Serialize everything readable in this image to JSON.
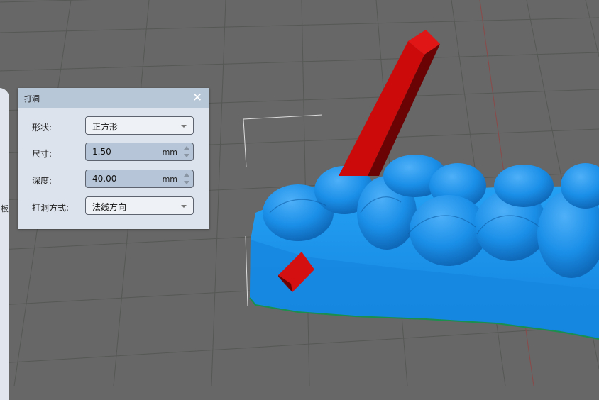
{
  "dialog": {
    "title": "打洞",
    "fields": {
      "shape": {
        "label": "形状:",
        "value": "正方形"
      },
      "size": {
        "label": "尺寸:",
        "value": "1.50",
        "unit": "mm"
      },
      "depth": {
        "label": "深度:",
        "value": "40.00",
        "unit": "mm"
      },
      "method": {
        "label": "打洞方式:",
        "value": "法线方向"
      }
    }
  },
  "side_panel": {
    "visible_char": "板"
  },
  "colors": {
    "viewport_bg": "#666766",
    "model": "#1a8fe8",
    "drill_tool": "#cc0a0a",
    "dialog_bg": "#dde3ec",
    "dialog_header": "#b8c7d8"
  }
}
